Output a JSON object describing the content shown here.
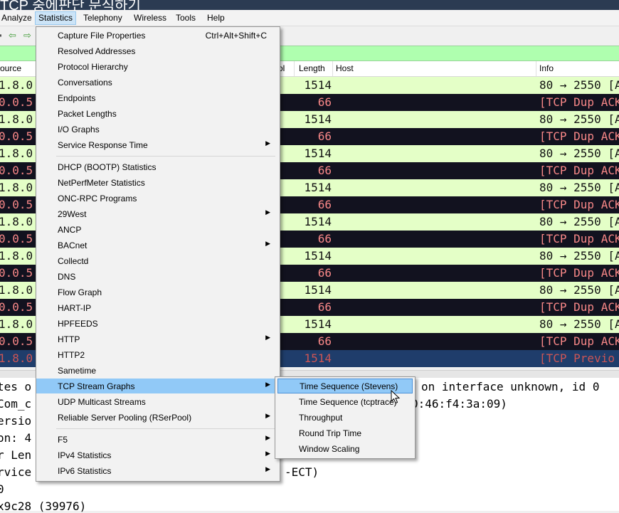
{
  "title_text": "TCP 중에판단 문식하기",
  "menubar": [
    {
      "label": "Analyze"
    },
    {
      "label": "Statistics",
      "active": true
    },
    {
      "label": "Telephony"
    },
    {
      "label": "Wireless"
    },
    {
      "label": "Tools"
    },
    {
      "label": "Help"
    }
  ],
  "toolbar_icons": [
    "arrow-left-icon",
    "arrow-right-icon"
  ],
  "columns": [
    "ource",
    "ol",
    "Length",
    "Host",
    "Info"
  ],
  "rows": [
    {
      "src": "1.8.0",
      "len": "1514",
      "info": "80 → 2550 [A",
      "kind": "ok"
    },
    {
      "src": "0.0.5",
      "len": "66",
      "info": "[TCP Dup ACK",
      "kind": "dup"
    },
    {
      "src": "1.8.0",
      "len": "1514",
      "info": "80 → 2550 [A",
      "kind": "ok"
    },
    {
      "src": "0.0.5",
      "len": "66",
      "info": "[TCP Dup ACK",
      "kind": "dup"
    },
    {
      "src": "1.8.0",
      "len": "1514",
      "info": "80 → 2550 [A",
      "kind": "ok"
    },
    {
      "src": "0.0.5",
      "len": "66",
      "info": "[TCP Dup ACK",
      "kind": "dup"
    },
    {
      "src": "1.8.0",
      "len": "1514",
      "info": "80 → 2550 [A",
      "kind": "ok"
    },
    {
      "src": "0.0.5",
      "len": "66",
      "info": "[TCP Dup ACK",
      "kind": "dup"
    },
    {
      "src": "1.8.0",
      "len": "1514",
      "info": "80 → 2550 [A",
      "kind": "ok"
    },
    {
      "src": "0.0.5",
      "len": "66",
      "info": "[TCP Dup ACK",
      "kind": "dup"
    },
    {
      "src": "1.8.0",
      "len": "1514",
      "info": "80 → 2550 [A",
      "kind": "ok"
    },
    {
      "src": "0.0.5",
      "len": "66",
      "info": "[TCP Dup ACK",
      "kind": "dup"
    },
    {
      "src": "1.8.0",
      "len": "1514",
      "info": "80 → 2550 [A",
      "kind": "ok"
    },
    {
      "src": "0.0.5",
      "len": "66",
      "info": "[TCP Dup ACK",
      "kind": "dup"
    },
    {
      "src": "1.8.0",
      "len": "1514",
      "info": "80 → 2550 [A",
      "kind": "ok"
    },
    {
      "src": "0.0.5",
      "len": "66",
      "info": "[TCP Dup ACK",
      "kind": "dup"
    },
    {
      "src": "1.8.0",
      "len": "1514",
      "info": "[TCP Previo",
      "kind": "sel"
    }
  ],
  "details": [
    "tes o",
    "Com_c",
    "ersio",
    "on: 4",
    "r Len",
    "rvice",
    "0",
    "x9c28 (39976)"
  ],
  "details_right": [
    {
      "text": "on interface unknown, id 0"
    },
    {
      "text": "0:46:f4:3a:09)"
    },
    {
      "text": "-ECT)"
    }
  ],
  "menu": [
    {
      "label": "Capture File Properties",
      "shortcut": "Ctrl+Alt+Shift+C",
      "name": "menu-item-capture-file-properties"
    },
    {
      "label": "Resolved Addresses",
      "name": "menu-item-resolved-addresses"
    },
    {
      "label": "Protocol Hierarchy",
      "name": "menu-item-protocol-hierarchy"
    },
    {
      "label": "Conversations",
      "name": "menu-item-conversations"
    },
    {
      "label": "Endpoints",
      "name": "menu-item-endpoints"
    },
    {
      "label": "Packet Lengths",
      "name": "menu-item-packet-lengths"
    },
    {
      "label": "I/O Graphs",
      "name": "menu-item-io-graphs"
    },
    {
      "label": "Service Response Time",
      "submenu": true,
      "name": "menu-item-service-response-time"
    },
    {
      "sep": true
    },
    {
      "label": "DHCP (BOOTP) Statistics",
      "name": "menu-item-dhcp-statistics"
    },
    {
      "label": "NetPerfMeter Statistics",
      "name": "menu-item-netperfmeter-statistics"
    },
    {
      "label": "ONC-RPC Programs",
      "name": "menu-item-onc-rpc-programs"
    },
    {
      "label": "29West",
      "submenu": true,
      "name": "menu-item-29west"
    },
    {
      "label": "ANCP",
      "name": "menu-item-ancp"
    },
    {
      "label": "BACnet",
      "submenu": true,
      "name": "menu-item-bacnet"
    },
    {
      "label": "Collectd",
      "name": "menu-item-collectd"
    },
    {
      "label": "DNS",
      "name": "menu-item-dns"
    },
    {
      "label": "Flow Graph",
      "name": "menu-item-flow-graph"
    },
    {
      "label": "HART-IP",
      "name": "menu-item-hart-ip"
    },
    {
      "label": "HPFEEDS",
      "name": "menu-item-hpfeeds"
    },
    {
      "label": "HTTP",
      "submenu": true,
      "name": "menu-item-http"
    },
    {
      "label": "HTTP2",
      "name": "menu-item-http2"
    },
    {
      "label": "Sametime",
      "name": "menu-item-sametime"
    },
    {
      "label": "TCP Stream Graphs",
      "submenu": true,
      "highlighted": true,
      "name": "menu-item-tcp-stream-graphs"
    },
    {
      "label": "UDP Multicast Streams",
      "name": "menu-item-udp-multicast-streams"
    },
    {
      "label": "Reliable Server Pooling (RSerPool)",
      "submenu": true,
      "name": "menu-item-rserpool"
    },
    {
      "sep": true
    },
    {
      "label": "F5",
      "submenu": true,
      "name": "menu-item-f5"
    },
    {
      "label": "IPv4 Statistics",
      "submenu": true,
      "name": "menu-item-ipv4-statistics"
    },
    {
      "label": "IPv6 Statistics",
      "submenu": true,
      "name": "menu-item-ipv6-statistics"
    }
  ],
  "submenu": [
    {
      "label": "Time Sequence (Stevens)",
      "highlighted": true,
      "name": "submenu-item-time-sequence-stevens"
    },
    {
      "label": "Time Sequence (tcptrace)",
      "name": "submenu-item-time-sequence-tcptrace"
    },
    {
      "label": "Throughput",
      "name": "submenu-item-throughput"
    },
    {
      "label": "Round Trip Time",
      "name": "submenu-item-round-trip-time"
    },
    {
      "label": "Window Scaling",
      "name": "submenu-item-window-scaling"
    }
  ],
  "colors": {
    "ok_row": "#e4ffc7",
    "dup_row": "#12121f",
    "dup_text": "#f78787",
    "filter_bar": "#afffaf",
    "menu_highlight": "#91c9f7"
  }
}
